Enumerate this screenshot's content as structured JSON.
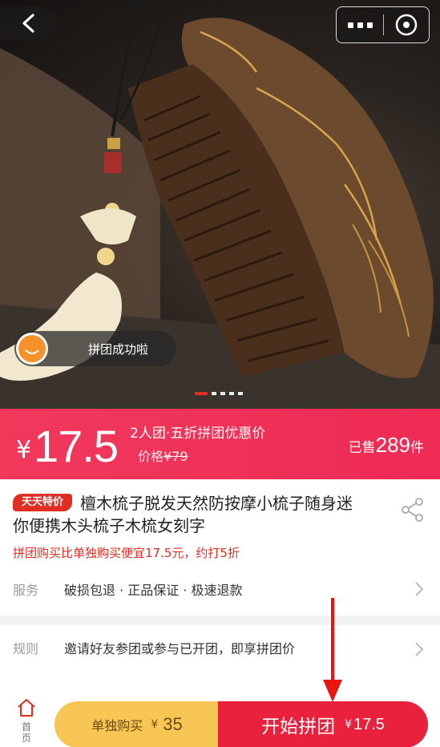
{
  "toast": {
    "text": "拼团成功啦"
  },
  "price_bar": {
    "currency": "¥",
    "price": "17.5",
    "group_desc": "2人团·五折拼团优惠价",
    "orig_label": "价格",
    "orig_price": "¥79",
    "sold_prefix": "已售",
    "sold_count": "289",
    "sold_suffix": "件"
  },
  "product": {
    "badge": "天天特价",
    "title_line1": "檀木梳子脱发天然防按摩小梳子随身迷",
    "title_line2": "你便携木头梳子木梳女刻字",
    "promo": "拼团购买比单独购买便宜17.5元，约打5折"
  },
  "service": {
    "label": "服务",
    "text": "破损包退 · 正品保证 · 极速退款"
  },
  "rule": {
    "label": "规则",
    "text": "邀请好友参团或参与已开团，即享拼团价"
  },
  "bottom": {
    "home_label_1": "首",
    "home_label_2": "页",
    "alone_label": "单独购买",
    "alone_currency": "¥",
    "alone_price": "35",
    "group_label": "开始拼团",
    "group_currency": "¥",
    "group_price": "17.5"
  },
  "colors": {
    "accent": "#e02e24",
    "price_bar": "#ef2d56",
    "alone_button": "#f7c655",
    "group_button": "#e9213d"
  },
  "carousel": {
    "count": 5,
    "active_index": 0
  }
}
